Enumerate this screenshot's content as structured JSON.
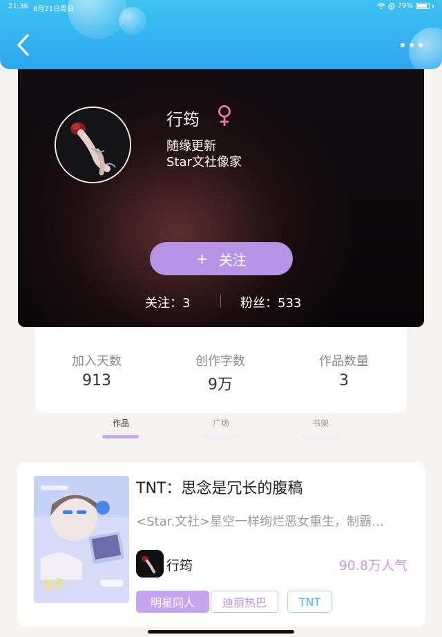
{
  "statusbar": {
    "time": "21:36",
    "date": "8月21日周日",
    "battery": "79%"
  },
  "header": {
    "back_icon": "chevron-left-icon",
    "more_icon": "more-horizontal-icon"
  },
  "profile": {
    "name": "行筠",
    "gender_icon": "female-icon",
    "desc_line1": "随缘更新",
    "desc_line2": "Star文社像家",
    "follow_plus": "+",
    "follow_label": "关注",
    "following_text": "关注：3",
    "fans_text": "粉丝：533"
  },
  "stats": [
    {
      "label": "加入天数",
      "value": "913"
    },
    {
      "label": "创作字数",
      "value": "9万"
    },
    {
      "label": "作品数量",
      "value": "3"
    }
  ],
  "tabs": [
    {
      "label": "作品",
      "active": true
    },
    {
      "label": "广场",
      "active": false
    },
    {
      "label": "书架",
      "active": false
    }
  ],
  "work": {
    "title": "TNT：思念是冗长的腹稿",
    "summary": "<Star.文社>星空一样绚烂恶女重生，制霸…",
    "author": "行筠",
    "popularity": "90.8万人气",
    "tags": [
      "明星同人",
      "迪丽热巴",
      "TNT"
    ]
  },
  "colors": {
    "header": "#2ea6ef",
    "accent": "#b794e6",
    "popularity": "#c49be9"
  }
}
